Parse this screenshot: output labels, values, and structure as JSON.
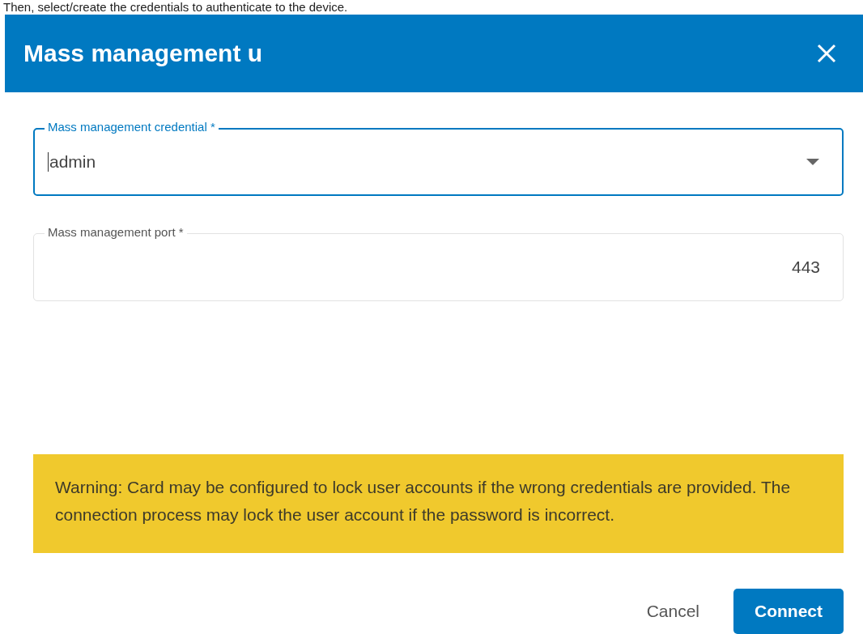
{
  "intro": "Then, select/create the credentials to authenticate to the device.",
  "dialog": {
    "title": "Mass management u",
    "fields": [
      {
        "kind": "select",
        "label": "Mass management credential *",
        "value": "admin",
        "focused": true
      },
      {
        "kind": "number",
        "label": "Mass management port *",
        "value": "443",
        "focused": false
      }
    ],
    "warning": "Warning: Card may be configured to lock user accounts if the wrong credentials are provided. The connection process may lock the user account if the password is incorrect.",
    "buttons": [
      {
        "kind": "text",
        "label": "Cancel"
      },
      {
        "kind": "primary",
        "label": "Connect"
      }
    ]
  }
}
